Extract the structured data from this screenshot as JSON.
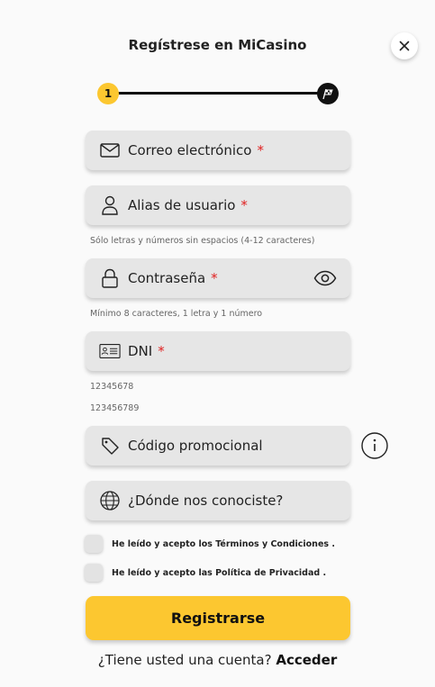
{
  "header": {
    "title": "Regístrese en MiCasino"
  },
  "stepper": {
    "current_step": "1",
    "total_steps": 2
  },
  "fields": {
    "email": {
      "label": "Correo electrónico",
      "required_mark": "*",
      "icon": "mail-icon"
    },
    "username": {
      "label": "Alias de usuario",
      "required_mark": "*",
      "hint": "Sólo letras y números sin espacios (4-12 caracteres)",
      "icon": "user-icon"
    },
    "password": {
      "label": "Contraseña",
      "required_mark": "*",
      "hint": "Mínimo 8 caracteres, 1 letra y 1 número",
      "icon": "lock-icon"
    },
    "dni": {
      "label": "DNI",
      "required_mark": "*",
      "hint_1": "12345678",
      "hint_2": "123456789",
      "icon": "id-card-icon"
    },
    "promo": {
      "label": "Código promocional",
      "icon": "tag-icon"
    },
    "referral": {
      "label": "¿Dónde nos conociste?",
      "icon": "globe-icon"
    }
  },
  "checks": {
    "terms": "He leído y acepto los Términos y Condiciones .",
    "privacy": "He leído y acepto las Política de Privacidad ."
  },
  "actions": {
    "register_label": "Registrarse"
  },
  "footer": {
    "question": "¿Tiene usted una cuenta?",
    "login_label": "Acceder"
  },
  "colors": {
    "accent": "#fcc730",
    "field_bg": "#e6e6e6",
    "required": "#e02020",
    "dark": "#111111"
  }
}
